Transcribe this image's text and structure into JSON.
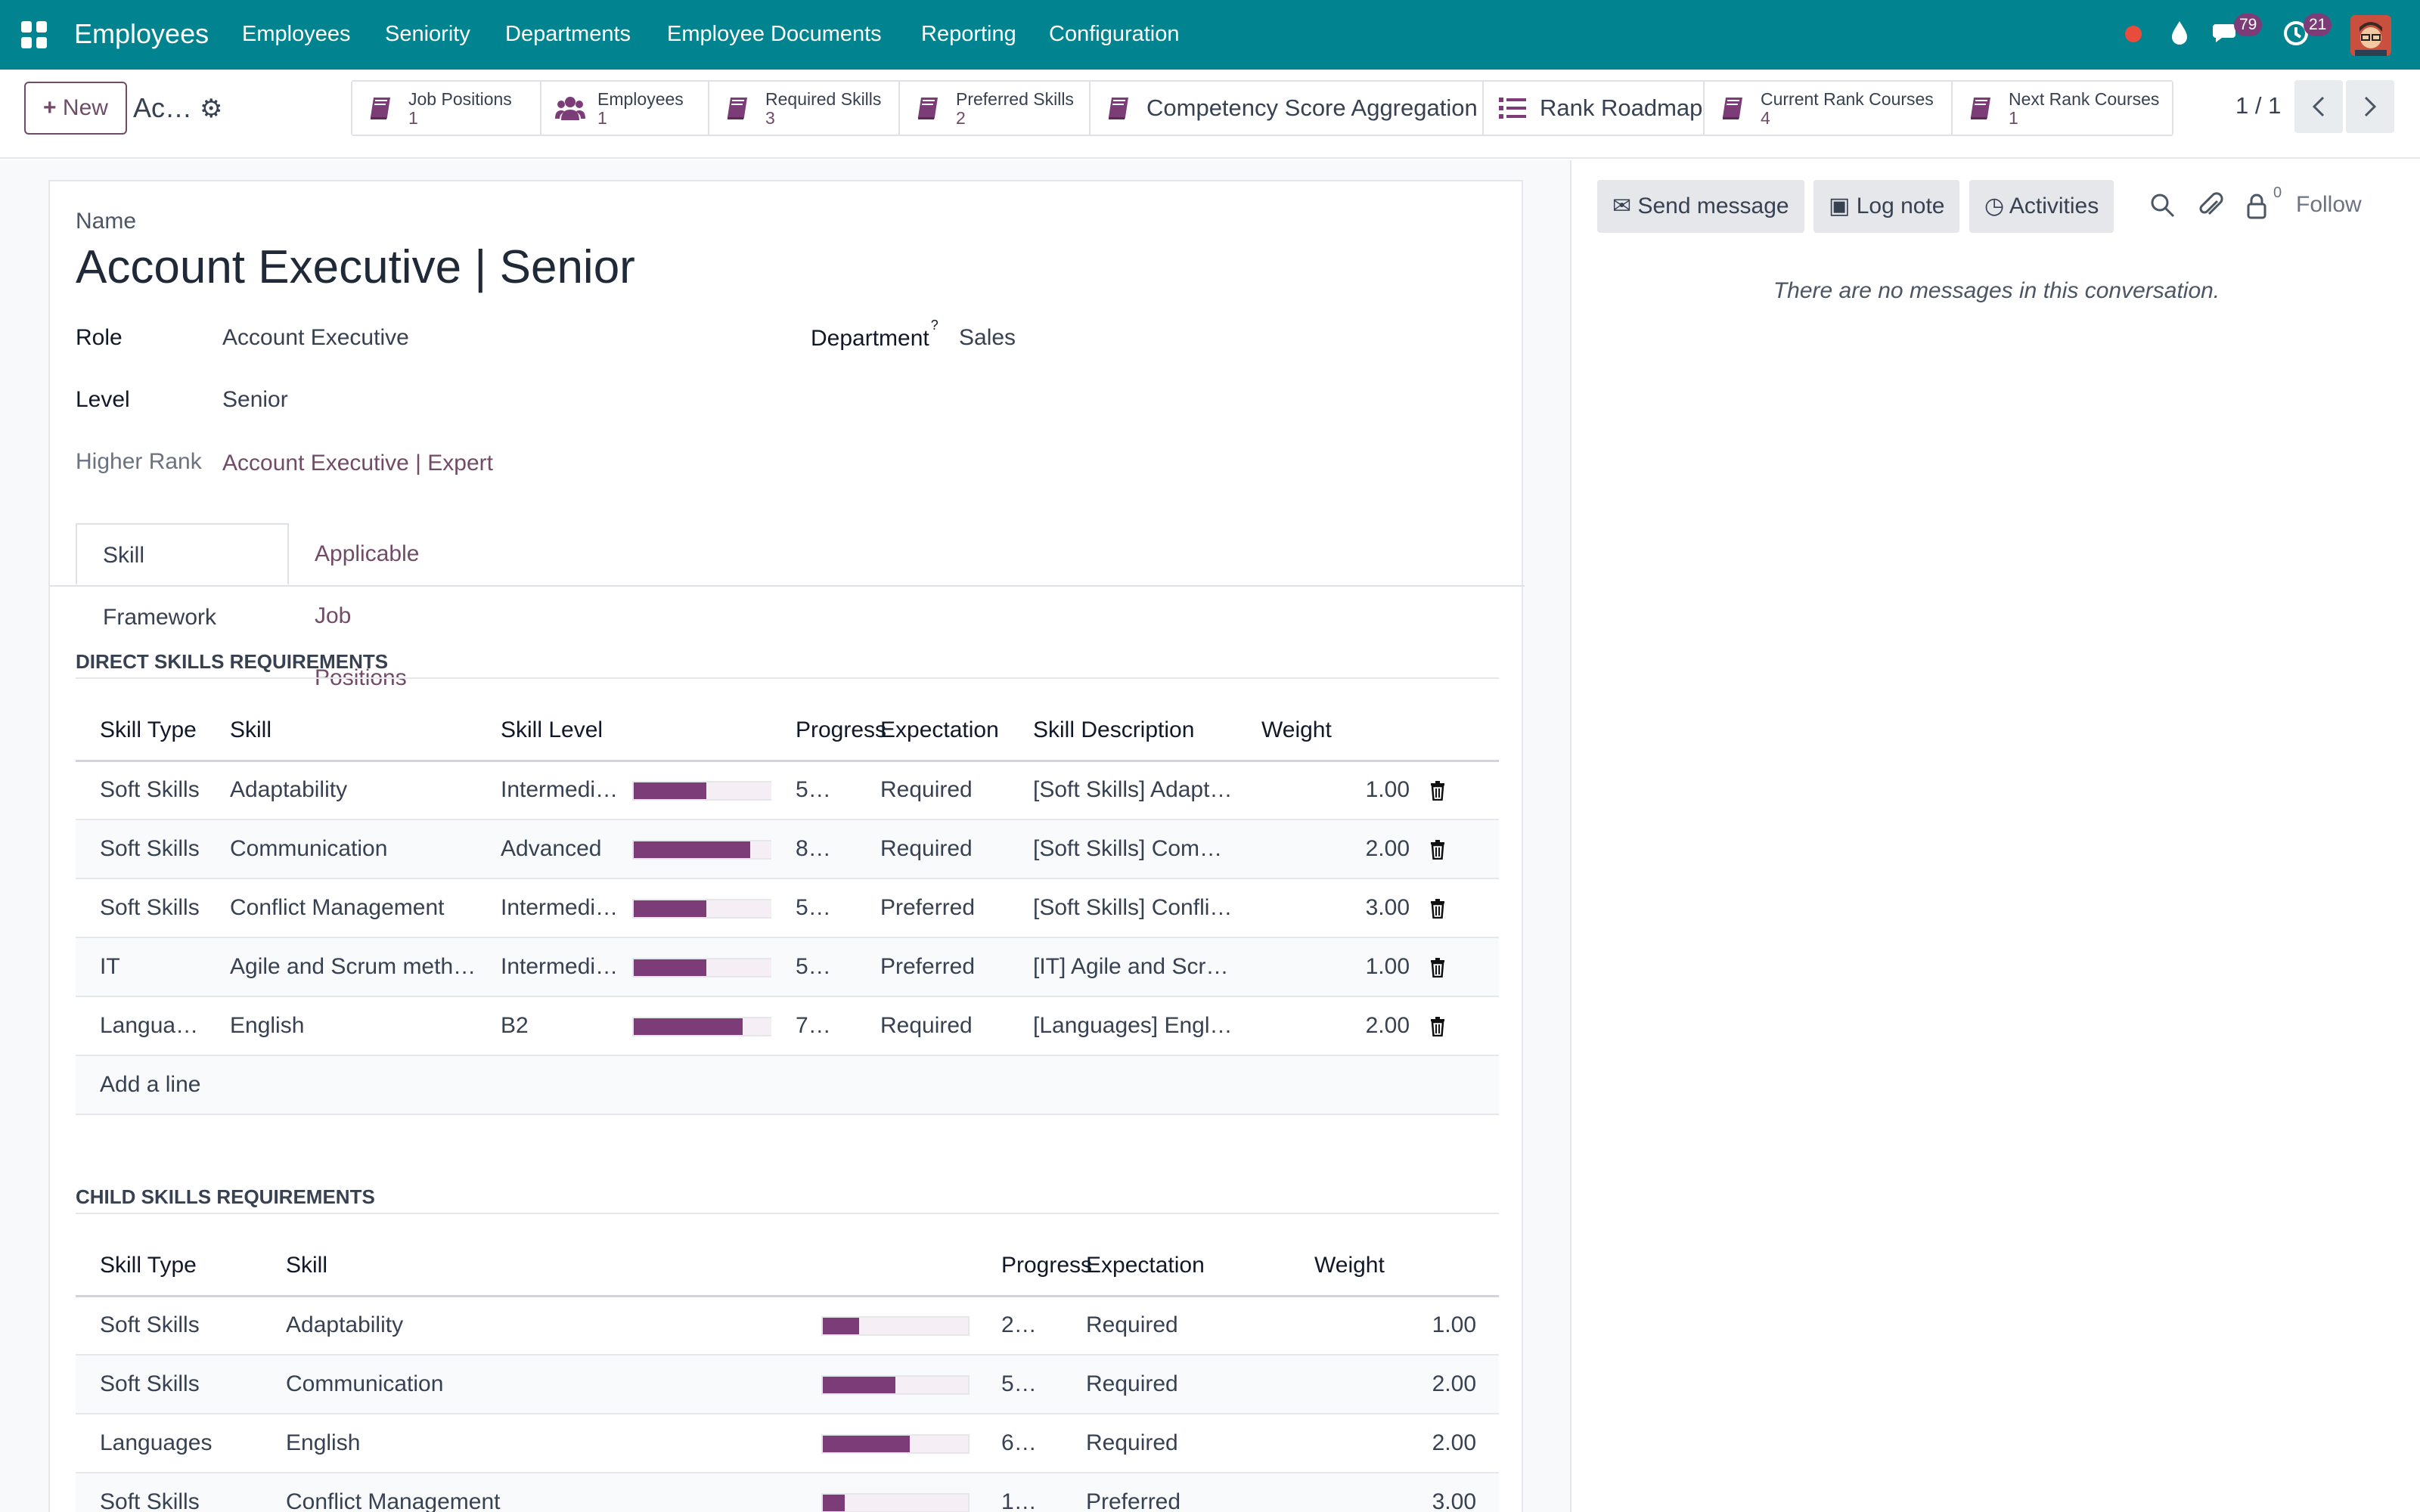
{
  "topbar": {
    "app_name": "Employees",
    "menu": [
      "Employees",
      "Seniority",
      "Departments",
      "Employee Documents",
      "Reporting",
      "Configuration"
    ],
    "messages_badge": "79",
    "activities_badge": "21",
    "color": "#01848f"
  },
  "control_panel": {
    "new_label": "New",
    "breadcrumb": "Ac…",
    "smart_buttons": [
      {
        "label": "Job Positions",
        "count": "1",
        "icon": "book-icon"
      },
      {
        "label": "Employees",
        "count": "1",
        "icon": "users-icon"
      },
      {
        "label": "Required Skills",
        "count": "3",
        "icon": "book-icon"
      },
      {
        "label": "Preferred Skills",
        "count": "2",
        "icon": "book-icon"
      },
      {
        "label": "Competency Score Aggregation",
        "icon": "book-icon"
      },
      {
        "label": "Rank Roadmap",
        "icon": "list-icon"
      },
      {
        "label": "Current Rank Courses",
        "count": "4",
        "icon": "book-icon"
      },
      {
        "label": "Next Rank Courses",
        "count": "1",
        "icon": "book-icon"
      }
    ],
    "pager": "1 / 1"
  },
  "form": {
    "name_label": "Name",
    "title": "Account Executive | Senior",
    "role_label": "Role",
    "role_value": "Account Executive",
    "department_label": "Department",
    "department_help": "?",
    "department_value": "Sales",
    "level_label": "Level",
    "level_value": "Senior",
    "higher_rank_label": "Higher Rank",
    "higher_rank_value": "Account Executive | Expert",
    "tabs": [
      "Skill Framework",
      "Applicable Job Positions"
    ]
  },
  "direct_skills": {
    "heading": "DIRECT SKILLS REQUIREMENTS",
    "columns": [
      "Skill Type",
      "Skill",
      "Skill Level",
      "Progress",
      "Expectation",
      "Skill Description",
      "Weight"
    ],
    "rows": [
      {
        "type": "Soft Skills",
        "skill": "Adaptability",
        "level": "Intermedia…",
        "progress": 50,
        "progress_label": "50 %",
        "expectation": "Required",
        "description": "[Soft Skills] Adaptabilit…",
        "weight": "1.00"
      },
      {
        "type": "Soft Skills",
        "skill": "Communication",
        "level": "Advanced",
        "progress": 80,
        "progress_label": "80 %",
        "expectation": "Required",
        "description": "[Soft Skills] Communic…",
        "weight": "2.00"
      },
      {
        "type": "Soft Skills",
        "skill": "Conflict Management",
        "level": "Intermedia…",
        "progress": 50,
        "progress_label": "50 %",
        "expectation": "Preferred",
        "description": "[Soft Skills] Conflict Ma…",
        "weight": "3.00"
      },
      {
        "type": "IT",
        "skill": "Agile and Scrum metho…",
        "level": "Intermedia…",
        "progress": 50,
        "progress_label": "50 %",
        "expectation": "Preferred",
        "description": "[IT] Agile and Scrum me…",
        "weight": "1.00"
      },
      {
        "type": "Languages",
        "skill": "English",
        "level": "B2",
        "progress": 75,
        "progress_label": "75 %",
        "expectation": "Required",
        "description": "[Languages] English - B2",
        "weight": "2.00"
      }
    ],
    "add_line": "Add a line"
  },
  "child_skills": {
    "heading": "CHILD SKILLS REQUIREMENTS",
    "columns": [
      "Skill Type",
      "Skill",
      "Progress",
      "Expectation",
      "Weight"
    ],
    "rows": [
      {
        "type": "Soft Skills",
        "skill": "Adaptability",
        "progress": 25,
        "progress_label": "25 %",
        "expectation": "Required",
        "weight": "1.00"
      },
      {
        "type": "Soft Skills",
        "skill": "Communication",
        "progress": 50,
        "progress_label": "50 %",
        "expectation": "Required",
        "weight": "2.00"
      },
      {
        "type": "Languages",
        "skill": "English",
        "progress": 60,
        "progress_label": "60 %",
        "expectation": "Required",
        "weight": "2.00"
      },
      {
        "type": "Soft Skills",
        "skill": "Conflict Management",
        "progress": 15,
        "progress_label": "15 %",
        "expectation": "Preferred",
        "weight": "3.00"
      }
    ]
  },
  "chatter": {
    "send_message": "Send message",
    "log_note": "Log note",
    "activities": "Activities",
    "followers_count": "0",
    "follow": "Follow",
    "empty": "There are no messages in this conversation."
  },
  "colors": {
    "accent": "#714b67",
    "progress": "#7c3c78"
  }
}
